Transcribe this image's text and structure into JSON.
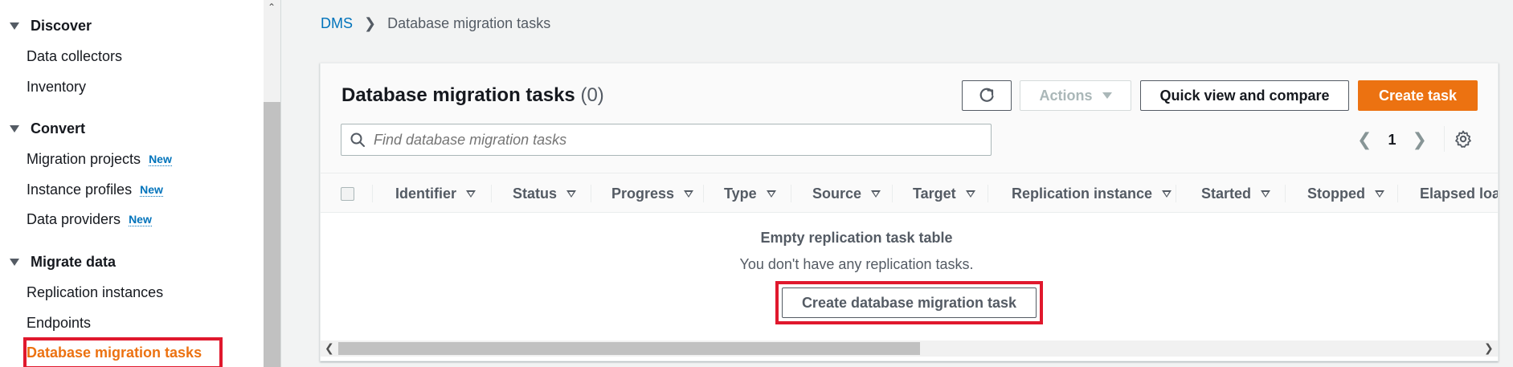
{
  "sidebar": {
    "sections": [
      {
        "label": "Discover",
        "items": [
          "Data collectors",
          "Inventory"
        ]
      },
      {
        "label": "Convert",
        "items": [
          "Migration projects",
          "Instance profiles",
          "Data providers"
        ]
      },
      {
        "label": "Migrate data",
        "items": [
          "Replication instances",
          "Endpoints",
          "Database migration tasks"
        ]
      }
    ],
    "new_badge": "New",
    "active_item": "Database migration tasks"
  },
  "breadcrumb": {
    "root": "DMS",
    "current": "Database migration tasks"
  },
  "panel": {
    "title": "Database migration tasks",
    "count": "(0)",
    "actions_label": "Actions",
    "quick_view_label": "Quick view and compare",
    "create_label": "Create task",
    "search_placeholder": "Find database migration tasks",
    "page_number": "1"
  },
  "table": {
    "columns": [
      "Identifier",
      "Status",
      "Progress",
      "Type",
      "Source",
      "Target",
      "Replication instance",
      "Started",
      "Stopped",
      "Elapsed loa"
    ]
  },
  "empty_state": {
    "title": "Empty replication task table",
    "description": "You don't have any replication tasks.",
    "button_label": "Create database migration task"
  },
  "colors": {
    "accent": "#ec7211",
    "link": "#0073bb",
    "highlight": "#e0182d"
  },
  "icons": [
    "chevron-down-icon",
    "refresh-icon",
    "search-icon",
    "chevron-left-icon",
    "chevron-right-icon",
    "settings-gear-icon",
    "sort-icon"
  ]
}
